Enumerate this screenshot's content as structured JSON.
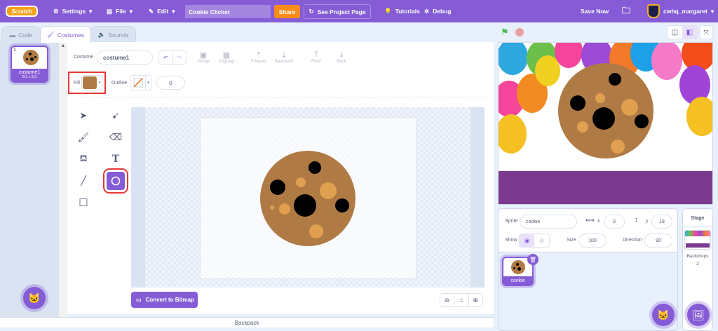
{
  "menubar": {
    "logo": "Scratch",
    "settings": "Settings",
    "file": "File",
    "edit": "Edit",
    "project_title": "Cookie Clicker",
    "share": "Share",
    "see_project_page": "See Project Page",
    "tutorials": "Tutorials",
    "debug": "Debug",
    "save_now": "Save Now",
    "username": "cwhq_margaret"
  },
  "tabs": [
    {
      "label": "Code"
    },
    {
      "label": "Costumes"
    },
    {
      "label": "Sounds"
    }
  ],
  "costumes": [
    {
      "index": "1",
      "name": "costume1",
      "size": "211 x 211"
    }
  ],
  "paint": {
    "costume_label": "Costume",
    "costume_name": "costume1",
    "group": "Group",
    "ungroup": "Ungroup",
    "forward": "Forward",
    "backward": "Backward",
    "front": "Front",
    "back": "Back",
    "fill_label": "Fill",
    "fill_color": "#b07a45",
    "outline_label": "Outline",
    "outline_width": "0",
    "selected_tool": "circle",
    "convert": "Convert to Bitmap"
  },
  "backpack": "Backpack",
  "sprite_info": {
    "sprite_label": "Sprite",
    "sprite_name": "cookie",
    "x_label": "x",
    "x": "0",
    "y_label": "y",
    "y": "18",
    "show_label": "Show",
    "size_label": "Size",
    "size": "100",
    "direction_label": "Direction",
    "direction": "90"
  },
  "sprites": [
    {
      "name": "cookie"
    }
  ],
  "stage_panel": {
    "title": "Stage",
    "backdrops_label": "Backdrops",
    "backdrops_count": "2"
  },
  "colors": {
    "accent": "#855cd6",
    "share": "#ff8c1a",
    "cookie": "#b07a45",
    "chip": "#e0a050",
    "stage_band": "#7b3a8f"
  }
}
